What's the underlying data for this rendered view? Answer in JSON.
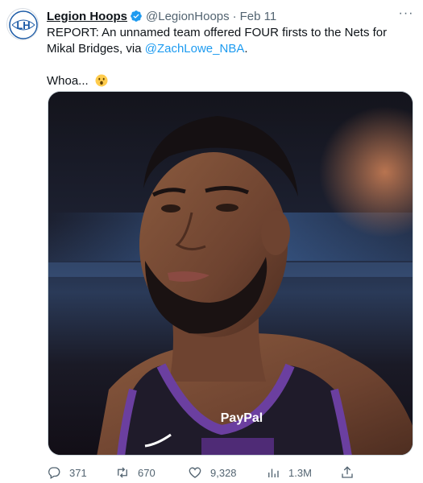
{
  "tweet": {
    "display_name": "Legion Hoops",
    "handle": "@LegionHoops",
    "separator": "·",
    "timestamp": "Feb 11",
    "avatar_text": "LH",
    "text_line1": "REPORT: An unnamed team offered FOUR firsts to the Nets for Mikal Bridges, via ",
    "mention": "@ZachLowe_NBA",
    "text_line1_end": ".",
    "text_line2": "Whoa...",
    "more_label": "···",
    "jersey_sponsor": "PayPal"
  },
  "actions": {
    "replies": "371",
    "retweets": "670",
    "likes": "9,328",
    "views": "1.3M"
  },
  "colors": {
    "accent": "#1d9bf0",
    "text": "#0f1419",
    "muted": "#536471",
    "jersey": "#1f1b2a",
    "jersey_trim": "#6b3fa0"
  },
  "icons": {
    "verified": "verified-badge-icon",
    "reply": "reply-icon",
    "retweet": "retweet-icon",
    "like": "heart-icon",
    "views": "views-icon",
    "share": "share-icon",
    "emoji": "surprised-face-icon"
  }
}
